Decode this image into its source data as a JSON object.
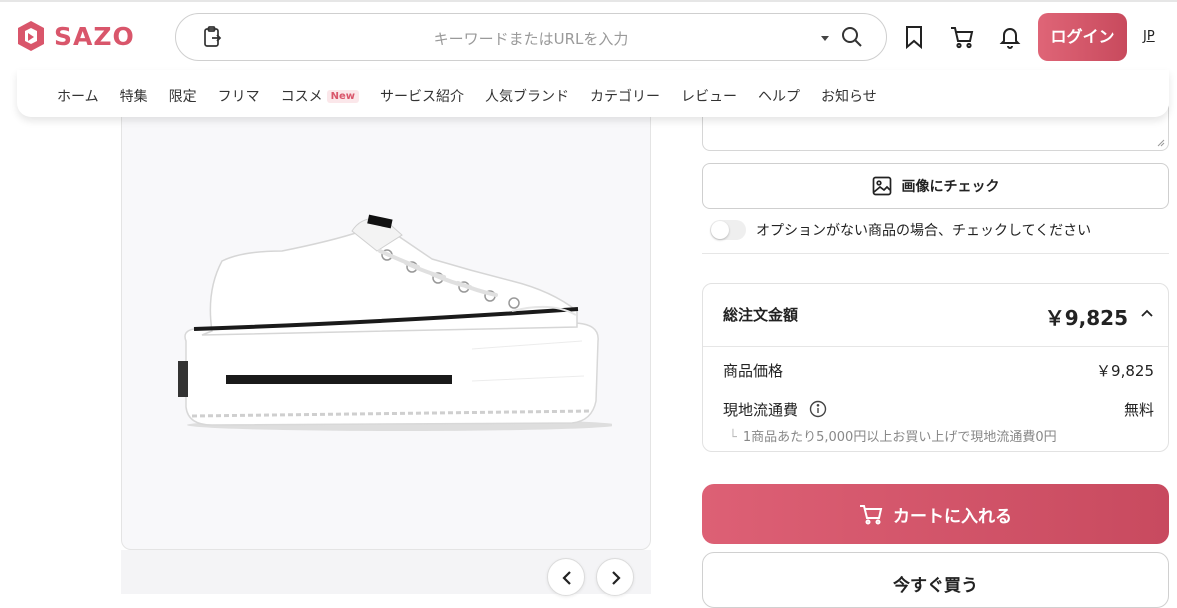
{
  "header": {
    "logo_text": "SAZO",
    "brand_color": "#d9566b",
    "search": {
      "placeholder": "キーワードまたはURLを入力"
    },
    "icons": [
      "clipboard-icon",
      "dropdown-caret-icon",
      "search-icon",
      "bookmark-icon",
      "cart-icon",
      "bell-icon"
    ],
    "login_label": "ログイン",
    "language": "JP"
  },
  "nav": {
    "items": [
      {
        "label": "ホーム"
      },
      {
        "label": "特集"
      },
      {
        "label": "限定"
      },
      {
        "label": "フリマ"
      },
      {
        "label": "コスメ",
        "badge": "New"
      },
      {
        "label": "サービス紹介"
      },
      {
        "label": "人気ブランド"
      },
      {
        "label": "カテゴリー"
      },
      {
        "label": "レビュー"
      },
      {
        "label": "ヘルプ"
      },
      {
        "label": "お知らせ"
      }
    ]
  },
  "product": {
    "image": "white-platform-sneaker",
    "prev_icon": "chevron-left-icon",
    "next_icon": "chevron-right-icon"
  },
  "options": {
    "image_check_label": "画像にチェック",
    "no_option_label": "オプションがない商品の場合、チェックしてください",
    "no_option_checked": false
  },
  "summary": {
    "total_label": "総注文金額",
    "total_value": "￥9,825",
    "item_price_label": "商品価格",
    "item_price_value": "￥9,825",
    "shipping_label": "現地流通費",
    "shipping_value": "無料",
    "shipping_note": "1商品あたり5,000円以上お買い上げで現地流通費0円"
  },
  "actions": {
    "cart_label": "カートに入れる",
    "buy_now_label": "今すぐ買う",
    "accent_color": "#d45a6e"
  }
}
